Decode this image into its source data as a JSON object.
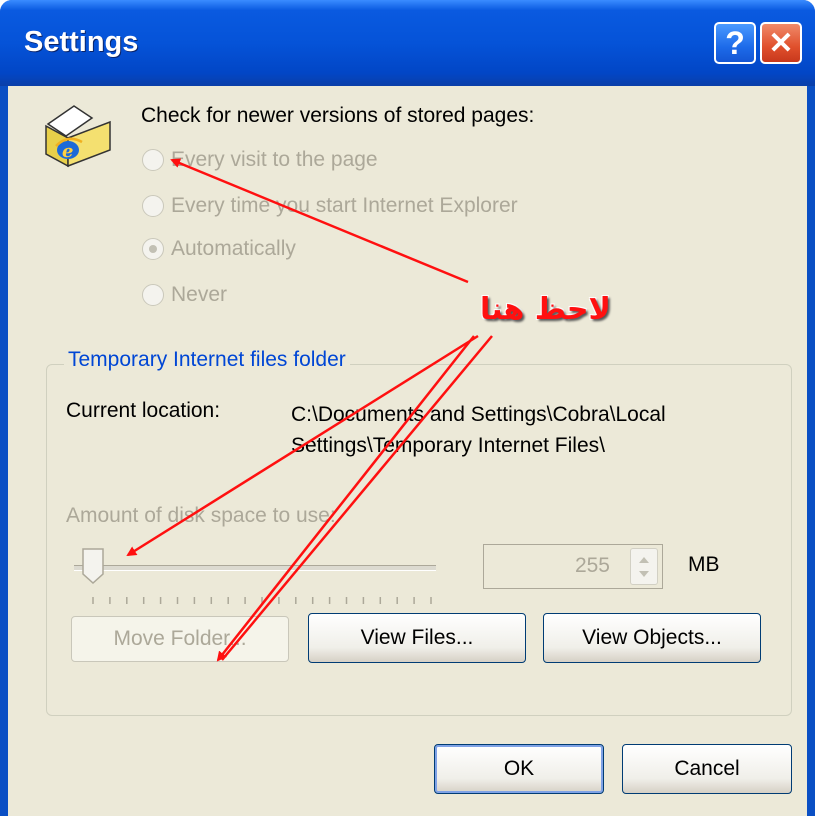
{
  "window": {
    "title": "Settings",
    "help_glyph": "?",
    "close_glyph": "✕"
  },
  "check": {
    "label": "Check for newer versions of stored pages:",
    "icon": "ie-folder-icon",
    "options": [
      {
        "label": "Every visit to the page",
        "selected": false
      },
      {
        "label": "Every time you start Internet Explorer",
        "selected": false
      },
      {
        "label": "Automatically",
        "selected": true
      },
      {
        "label": "Never",
        "selected": false
      }
    ]
  },
  "group": {
    "title": "Temporary Internet files folder",
    "current_location_label": "Current location:",
    "current_location_value": "C:\\Documents and Settings\\Cobra\\Local Settings\\Temporary Internet Files\\",
    "disk_label": "Amount of disk space to use:",
    "disk_value": "255",
    "disk_unit": "MB",
    "slider_level_fraction": 0.05
  },
  "buttons": {
    "move_folder": "Move Folder...",
    "view_files": "View Files...",
    "view_objects": "View Objects...",
    "ok": "OK",
    "cancel": "Cancel"
  },
  "annotation": {
    "text": "لاحظ هنا",
    "color": "#ff1010"
  }
}
